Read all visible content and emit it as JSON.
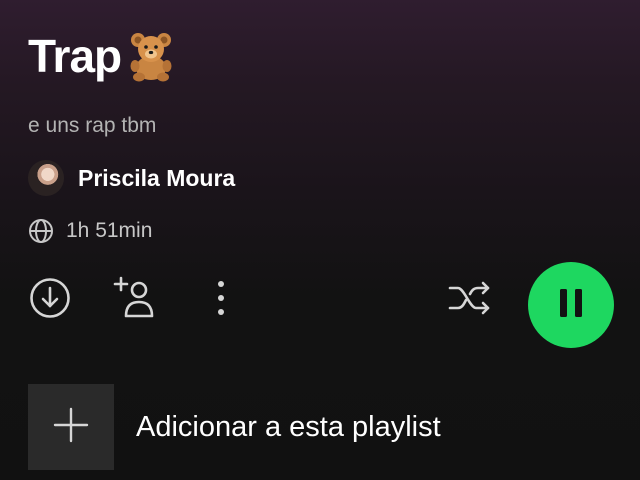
{
  "playlist": {
    "title": "Trap",
    "title_emoji": "teddy-bear-emoji",
    "description": "e uns rap tbm",
    "owner": "Priscila Moura",
    "duration": "1h 51min"
  },
  "actions": {
    "download_icon": "download-circle-icon",
    "add_user_icon": "add-user-icon",
    "more_icon": "more-vertical-icon",
    "shuffle_icon": "shuffle-icon",
    "play_state": "pause-icon"
  },
  "add_section": {
    "icon": "plus-icon",
    "label": "Adicionar a esta playlist"
  },
  "colors": {
    "accent_green": "#1ed760",
    "text_primary": "#ffffff",
    "text_secondary": "#b3b3b3",
    "background": "#121212",
    "header_tint": "#2f1d2f"
  }
}
